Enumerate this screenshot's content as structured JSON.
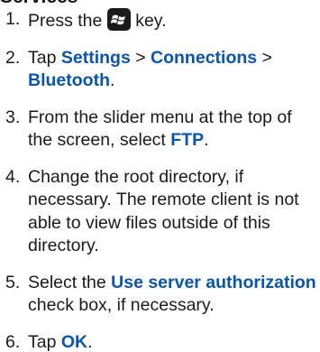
{
  "section": {
    "heading": "Services"
  },
  "steps": [
    {
      "num": "1.",
      "pre": "Press the ",
      "icon": "windows-key-icon",
      "post": " key."
    },
    {
      "num": "2.",
      "pre": "Tap ",
      "b1": "Settings",
      "mid1": " > ",
      "b2": "Connections",
      "mid2": " > ",
      "b3": "Bluetooth",
      "post": "."
    },
    {
      "num": "3.",
      "pre": "From the slider menu at the top of the screen, select ",
      "b1": "FTP",
      "post": "."
    },
    {
      "num": "4.",
      "text": "Change the root directory, if necessary. The remote client is not able to view files outside of this directory."
    },
    {
      "num": "5.",
      "pre": "Select the ",
      "b1": "Use server authorization",
      "post": " check box, if necessary."
    },
    {
      "num": "6.",
      "pre": "Tap ",
      "b1": "OK",
      "post": "."
    }
  ],
  "colors": {
    "text": "#1a1a1a",
    "emphasis": "#0b55a8",
    "key_background": "#1b1b1b"
  }
}
